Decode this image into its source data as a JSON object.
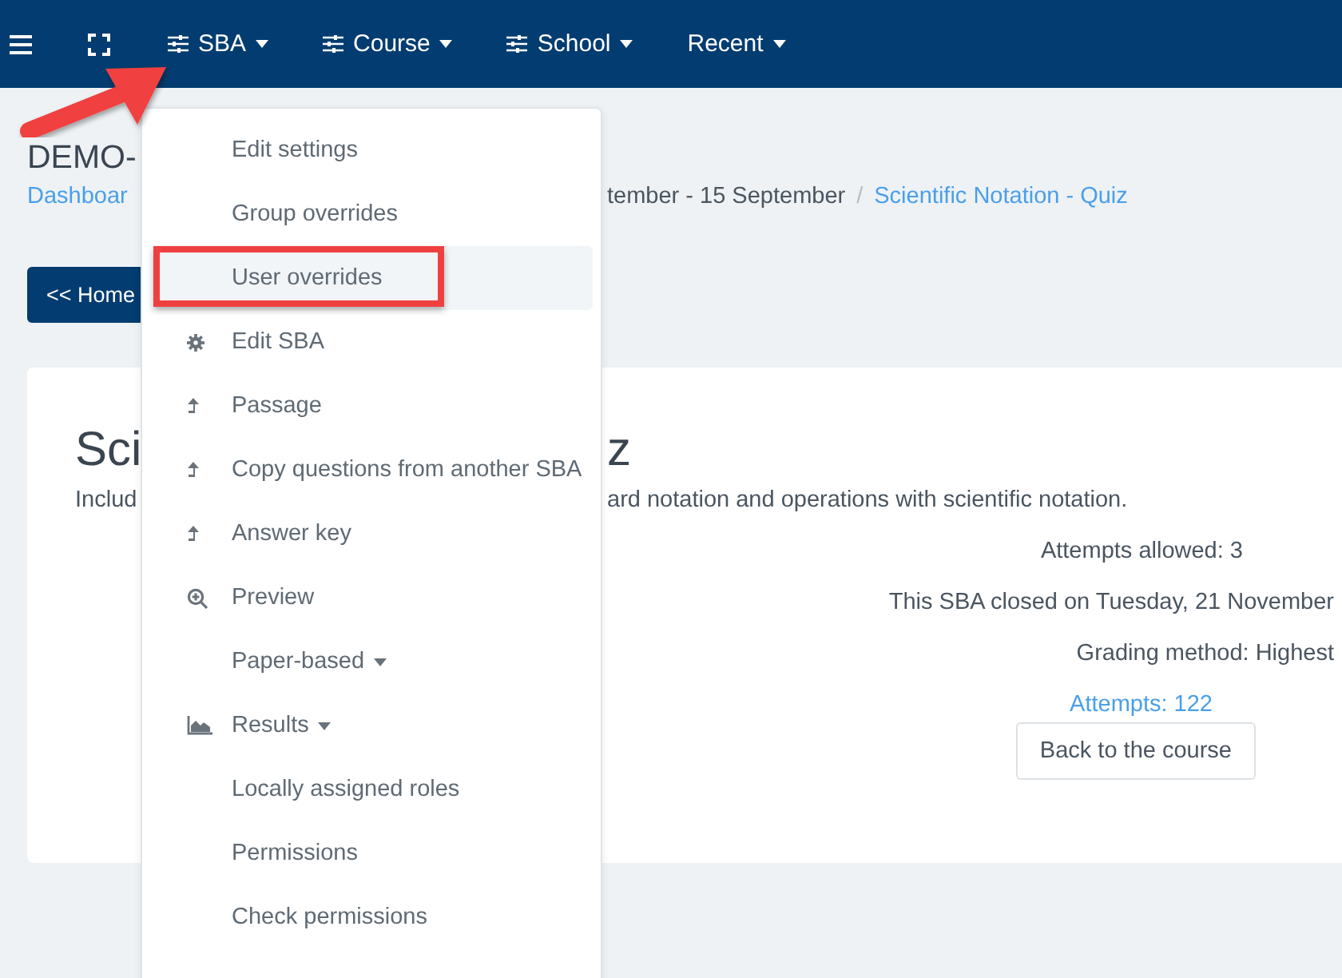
{
  "navbar": {
    "items": [
      {
        "label": "SBA"
      },
      {
        "label": "Course"
      },
      {
        "label": "School"
      },
      {
        "label": "Recent"
      }
    ]
  },
  "header": {
    "title": "DEMO-",
    "breadcrumb_link": "Dashboar",
    "breadcrumb_text": "tember - 15 September",
    "breadcrumb_separator": "/",
    "breadcrumb_current": "Scientific Notation - Quiz"
  },
  "home_button": "<< Home",
  "card": {
    "title_left": "Sci",
    "title_right": "z",
    "description_left": "Includ",
    "description_right": "ard notation and operations with scientific notation.",
    "attempts_allowed": "Attempts allowed: 3",
    "closed_note": "This SBA closed on Tuesday, 21 November",
    "grading_method": "Grading method: Highest",
    "attempts_link": "Attempts: 122",
    "back_button": "Back to the course"
  },
  "menu": {
    "items": [
      {
        "label": "Edit settings",
        "kind": "plain",
        "caret": false,
        "selected": false,
        "outlined": false
      },
      {
        "label": "Group overrides",
        "kind": "plain",
        "caret": false,
        "selected": false,
        "outlined": false
      },
      {
        "label": "User overrides",
        "kind": "plain",
        "caret": false,
        "selected": true,
        "outlined": true
      },
      {
        "label": "Edit SBA",
        "kind": "gear",
        "caret": false,
        "selected": false,
        "outlined": false
      },
      {
        "label": "Passage",
        "kind": "upload",
        "caret": false,
        "selected": false,
        "outlined": false
      },
      {
        "label": "Copy questions from another SBA",
        "kind": "upload",
        "caret": false,
        "selected": false,
        "outlined": false
      },
      {
        "label": "Answer key",
        "kind": "upload",
        "caret": false,
        "selected": false,
        "outlined": false
      },
      {
        "label": "Preview",
        "kind": "zoom",
        "caret": false,
        "selected": false,
        "outlined": false
      },
      {
        "label": "Paper-based",
        "kind": "plain",
        "caret": true,
        "selected": false,
        "outlined": false
      },
      {
        "label": "Results",
        "kind": "chart",
        "caret": true,
        "selected": false,
        "outlined": false
      },
      {
        "label": "Locally assigned roles",
        "kind": "plain",
        "caret": false,
        "selected": false,
        "outlined": false
      },
      {
        "label": "Permissions",
        "kind": "plain",
        "caret": false,
        "selected": false,
        "outlined": false
      },
      {
        "label": "Check permissions",
        "kind": "plain",
        "caret": false,
        "selected": false,
        "outlined": false
      }
    ]
  }
}
